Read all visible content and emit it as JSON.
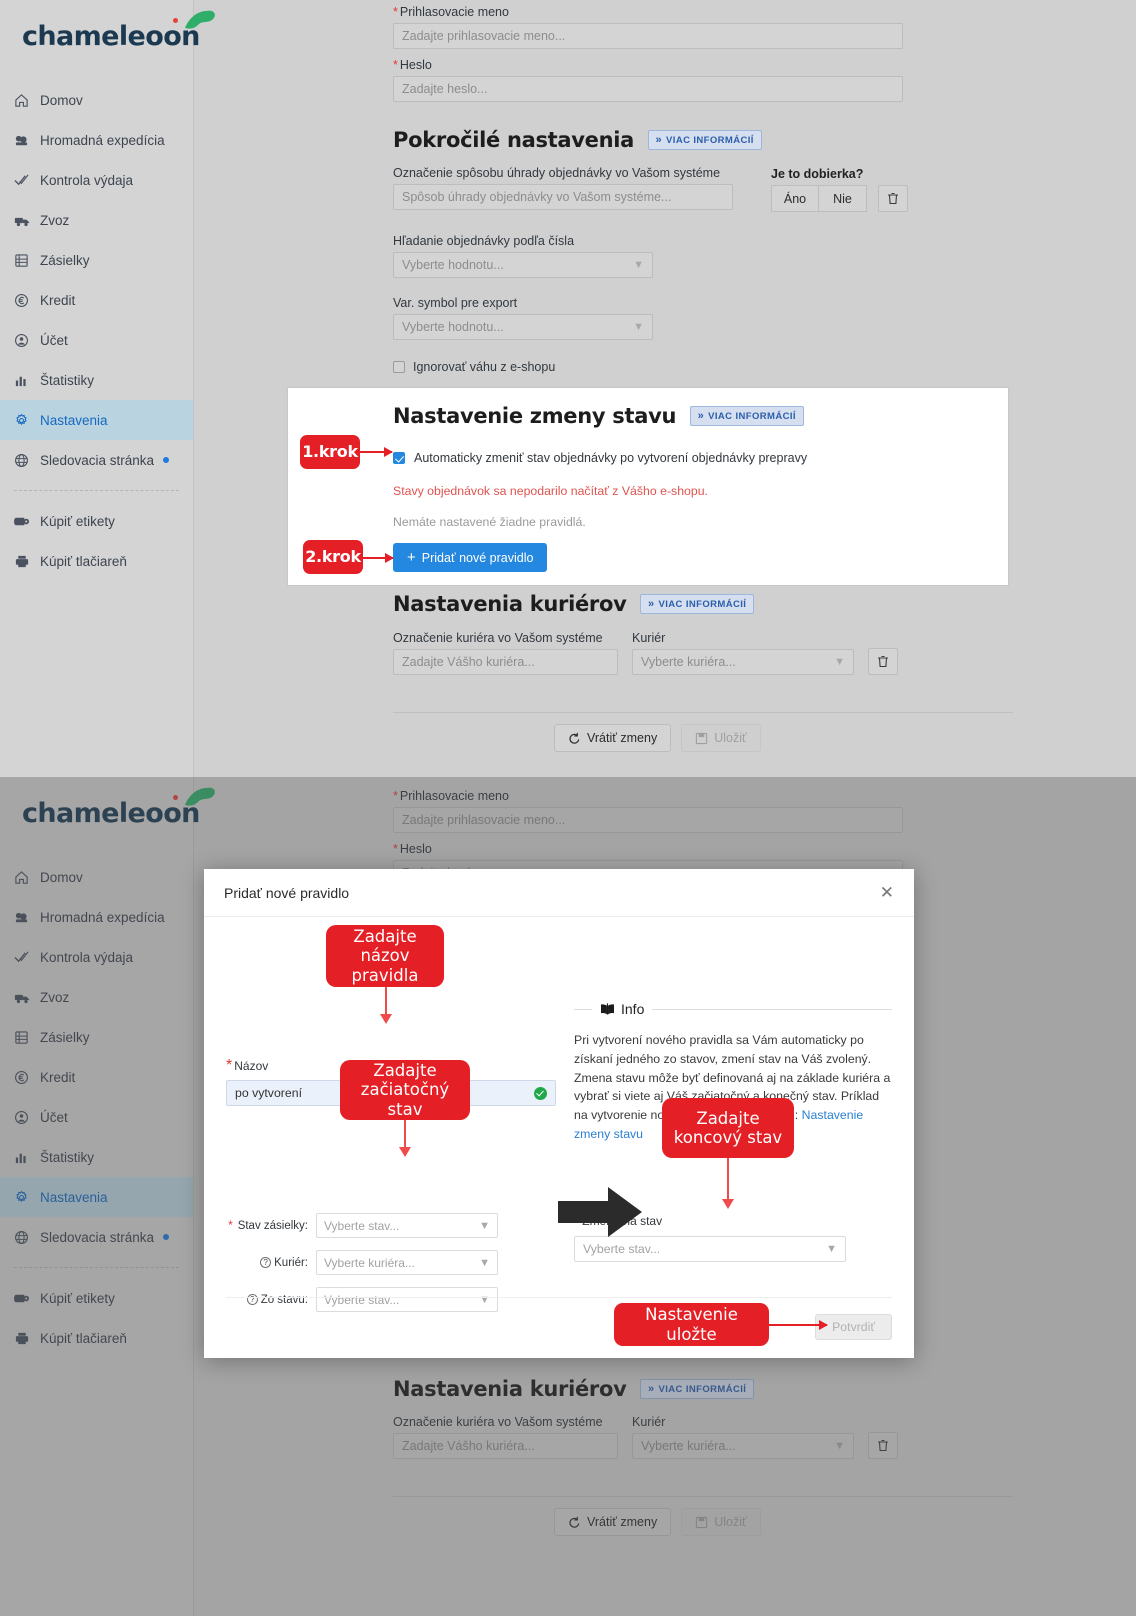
{
  "brand": {
    "name": "chameleoon",
    "accent": "#1b3a52",
    "dot": "#e8413a"
  },
  "sidebar": {
    "items": [
      {
        "label": "Domov",
        "icon": "home-icon"
      },
      {
        "label": "Hromadná expedícia",
        "icon": "boxes-icon"
      },
      {
        "label": "Kontrola výdaja",
        "icon": "double-check-icon"
      },
      {
        "label": "Zvoz",
        "icon": "truck-icon"
      },
      {
        "label": "Zásielky",
        "icon": "package-list-icon"
      },
      {
        "label": "Kredit",
        "icon": "euro-icon"
      },
      {
        "label": "Účet",
        "icon": "user-circle-icon"
      },
      {
        "label": "Štatistiky",
        "icon": "bar-chart-icon"
      },
      {
        "label": "Nastavenia",
        "icon": "gear-icon",
        "active": true
      },
      {
        "label": "Sledovacia stránka",
        "icon": "globe-icon",
        "badge_dot": true
      }
    ],
    "bottom_items": [
      {
        "label": "Kúpiť etikety",
        "icon": "label-roll-icon"
      },
      {
        "label": "Kúpiť tlačiareň",
        "icon": "printer-icon"
      }
    ]
  },
  "form": {
    "login_label": "Prihlasovacie meno",
    "login_placeholder": "Zadajte prihlasovacie meno...",
    "password_label": "Heslo",
    "password_placeholder": "Zadajte heslo..."
  },
  "advanced": {
    "title": "Pokročilé nastavenia",
    "more_info": "VIAC INFORMÁCIÍ",
    "payment_label": "Označenie spôsobu úhrady objednávky vo Vašom systéme",
    "payment_placeholder": "Spôsob úhrady objednávky vo Vašom systéme...",
    "cod_label": "Je to dobierka?",
    "cod_yes": "Áno",
    "cod_no": "Nie",
    "search_label": "Hľadanie objednávky podľa čísla",
    "search_placeholder": "Vyberte hodnotu...",
    "varsym_label": "Var. symbol pre export",
    "varsym_placeholder": "Vyberte hodnotu...",
    "ignore_weight": "Ignorovať váhu z e-shopu"
  },
  "status_change": {
    "title": "Nastavenie zmeny stavu",
    "more_info": "VIAC INFORMÁCIÍ",
    "checkbox_label": "Automaticky zmeniť stav objednávky po vytvorení objednávky prepravy",
    "error_text": "Stavy objednávok sa nepodarilo načítať z Vášho e-shopu.",
    "empty_text": "Nemáte nastavené žiadne pravidlá.",
    "add_rule_button": "Pridať nové pravidlo",
    "step1": "1.krok",
    "step2": "2.krok"
  },
  "couriers": {
    "title": "Nastavenia kuriérov",
    "more_info": "VIAC INFORMÁCIÍ",
    "own_label": "Označenie kuriéra vo Vašom systéme",
    "own_placeholder": "Zadajte Vášho kuriéra...",
    "courier_label": "Kuriér",
    "courier_placeholder": "Vyberte kuriéra..."
  },
  "footer": {
    "revert": "Vrátiť zmeny",
    "save": "Uložiť"
  },
  "modal": {
    "title": "Pridať nové pravidlo",
    "name_label": "Názov",
    "name_value": "po vytvorení",
    "shipment_state_label": "Stav zásielky:",
    "shipment_state_placeholder": "Vyberte stav...",
    "courier_label": "Kuriér:",
    "courier_placeholder": "Vyberte kuriéra...",
    "from_state_label": "Zo stavu:",
    "from_state_placeholder": "Vyberte stav...",
    "target_state_label": "Zmeniť na stav",
    "target_state_placeholder": "Vyberte stav...",
    "info_title": "Info",
    "info_text": "Pri vytvorení nového pravidla sa Vám automaticky po získaní jedného zo stavov, zmení stav na Váš zvolený. Zmena stavu môže byť definovaná aj na základe kuriéra a vybrať si viete aj Váš začiatočný a konečný stav. Príklad na vytvorenie nového pravidla nájdete tu: ",
    "info_link": "Nastavenie zmeny stavu",
    "confirm": "Potvrdiť",
    "callout_name": "Zadajte názov pravidla",
    "callout_start": "Zadajte začiatočný stav",
    "callout_end": "Zadajte koncový stav",
    "callout_save": "Nastavenie uložte"
  }
}
